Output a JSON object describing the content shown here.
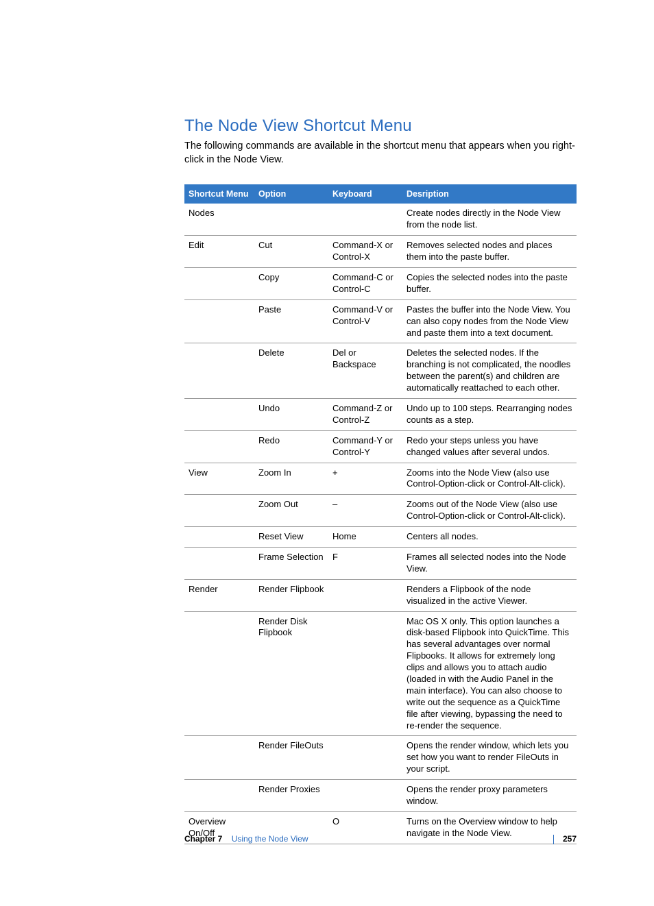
{
  "heading": "The Node View Shortcut Menu",
  "intro": "The following commands are available in the shortcut menu that appears when you right-click in the Node View.",
  "table": {
    "headers": {
      "menu": "Shortcut Menu",
      "option": "Option",
      "keyboard": "Keyboard",
      "description": "Desription"
    },
    "rows": [
      {
        "menu": "Nodes",
        "option": "",
        "keyboard": "",
        "description": "Create nodes directly in the Node View from the node list."
      },
      {
        "menu": "Edit",
        "option": "Cut",
        "keyboard": "Command-X or Control-X",
        "description": "Removes selected nodes and places them into the paste buffer."
      },
      {
        "menu": "",
        "option": "Copy",
        "keyboard": "Command-C or Control-C",
        "description": "Copies the selected nodes into the paste buffer."
      },
      {
        "menu": "",
        "option": "Paste",
        "keyboard": "Command-V or Control-V",
        "description": "Pastes the buffer into the Node View. You can also copy nodes from the Node View and paste them into a text document."
      },
      {
        "menu": "",
        "option": "Delete",
        "keyboard": "Del or Backspace",
        "description": "Deletes the selected nodes. If the branching is not complicated, the noodles between the parent(s) and children are automatically reattached to each other."
      },
      {
        "menu": "",
        "option": "Undo",
        "keyboard": "Command-Z or Control-Z",
        "description": "Undo up to 100 steps. Rearranging nodes counts as a step."
      },
      {
        "menu": "",
        "option": "Redo",
        "keyboard": "Command-Y or Control-Y",
        "description": "Redo your steps unless you have changed values after several undos."
      },
      {
        "menu": "View",
        "option": "Zoom In",
        "keyboard": "+",
        "description": "Zooms into the Node View (also use Control-Option-click or Control-Alt-click)."
      },
      {
        "menu": "",
        "option": "Zoom Out",
        "keyboard": "–",
        "description": "Zooms out of the Node View (also use Control-Option-click or Control-Alt-click)."
      },
      {
        "menu": "",
        "option": "Reset View",
        "keyboard": "Home",
        "description": "Centers all nodes."
      },
      {
        "menu": "",
        "option": "Frame Selection",
        "keyboard": "F",
        "description": "Frames all selected nodes into the Node View."
      },
      {
        "menu": "Render",
        "option": "Render Flipbook",
        "keyboard": "",
        "description": "Renders a Flipbook of the node visualized in the active Viewer."
      },
      {
        "menu": "",
        "option": "Render Disk Flipbook",
        "keyboard": "",
        "description": "Mac OS X only. This option launches a disk-based Flipbook into QuickTime. This has several advantages over normal Flipbooks. It allows for extremely long clips and allows you to attach audio (loaded in with the Audio Panel in the main interface). You can also choose to write out the sequence as a QuickTime file after viewing, bypassing the need to re-render the sequence."
      },
      {
        "menu": "",
        "option": "Render FileOuts",
        "keyboard": "",
        "description": "Opens the render window, which lets you set how you want to render FileOuts in your script."
      },
      {
        "menu": "",
        "option": "Render Proxies",
        "keyboard": "",
        "description": "Opens the render proxy parameters window."
      },
      {
        "menu": "Overview On/Off",
        "option": "",
        "keyboard": "O",
        "description": "Turns on the Overview window to help navigate in the Node View."
      }
    ]
  },
  "footer": {
    "chapter_label": "Chapter 7",
    "chapter_name": "Using the Node View",
    "page_number": "257"
  }
}
